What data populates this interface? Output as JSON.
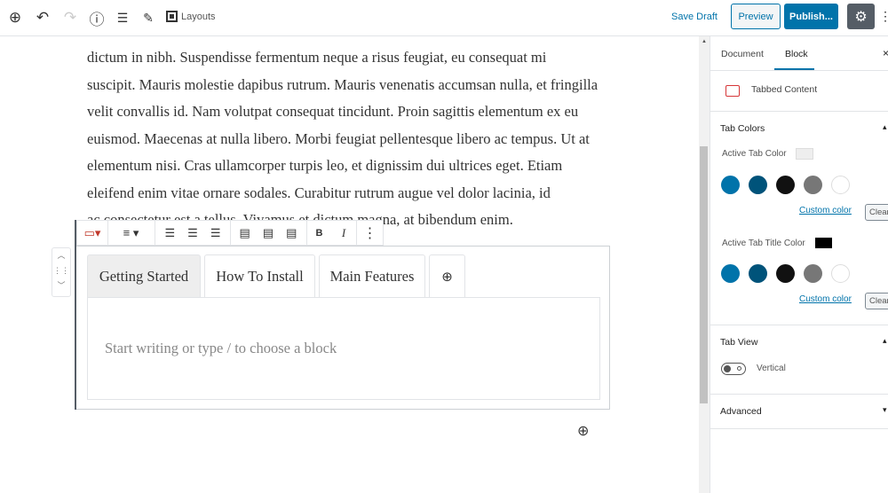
{
  "header": {
    "layouts_label": "Layouts",
    "save_draft": "Save Draft",
    "preview": "Preview",
    "publish": "Publish...",
    "accent": "#0073aa"
  },
  "content": {
    "paragraph_lines": [
      "dictum in nibh. Suspendisse fermentum neque a risus feugiat, eu consequat mi",
      "suscipit. Mauris molestie dapibus rutrum. Mauris venenatis accumsan nulla, et fringilla",
      "velit convallis id. Nam volutpat consequat tincidunt. Proin sagittis elementum ex eu",
      "euismod. Maecenas at nulla libero. Morbi feugiat pellentesque libero ac tempus. Ut at",
      "elementum nisi. Cras ullamcorper turpis leo, et dignissim dui ultrices eget. Etiam",
      "eleifend enim vitae ornare sodales. Curabitur rutrum augue vel dolor lacinia, id",
      "ac consectetur est a tellus. Vivamus et dictum magna, at bibendum enim."
    ]
  },
  "block": {
    "tabs": [
      "Getting Started",
      "How To Install",
      "Main Features"
    ],
    "placeholder": "Start writing or type / to choose a block",
    "bold": "B",
    "italic": "I"
  },
  "sidebar": {
    "tab_document": "Document",
    "tab_block": "Block",
    "block_name": "Tabbed Content",
    "tab_colors_title": "Tab Colors",
    "active_tab_color_label": "Active Tab Color",
    "active_tab_color": "#eeeeee",
    "active_tab_title_color_label": "Active Tab Title Color",
    "active_tab_title_color": "#000000",
    "palette": [
      "#0073aa",
      "#00537a",
      "#111111",
      "#777777",
      "#ffffff"
    ],
    "custom_color": "Custom color",
    "clear": "Clear",
    "tab_view_title": "Tab View",
    "vertical_label": "Vertical",
    "vertical_enabled": false,
    "advanced_title": "Advanced"
  }
}
